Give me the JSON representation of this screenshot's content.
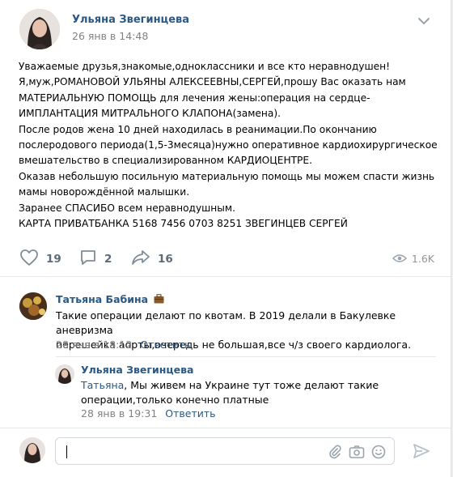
{
  "post": {
    "author": "Ульяна Звегинцева",
    "date": "26 янв в 14:48",
    "text": "Уважаемые друзья,знакомые,одноклассники и все кто неравнодушен!\nЯ,муж,РОМАНОВОЙ УЛЬЯНЫ АЛЕКСЕЕВНЫ,СЕРГЕЙ,прошу Вас оказать нам\nМАТЕРИАЛЬНУЮ ПОМОЩЬ для лечения жены:операция на сердце-\nИМПЛАНТАЦИЯ МИТРАЛЬНОГО КЛАПОНА(замена).\nПосле родов жена 10 дней находилась в реанимации.По окончанию\nпослеродового периода(1,5-3месяца)нужно оперативное кардиохирургическое\nвмешательство в специализированном КАРДИОЦЕНТРЕ.\nОказав небольшую посильную материальную помощь мы можем спасти жизнь\nмамы новорождённой малышки.\nЗаранее СПАСИБО всем неравнодушным.\nКАРТА ПРИВАТБАНКА 5168 7456 0703 8251 ЗВЕГИНЦЕВ СЕРГЕЙ"
  },
  "actions": {
    "likes": "19",
    "comments": "2",
    "shares": "16",
    "views": "1.6K"
  },
  "comments": [
    {
      "author": "Татьяна Бабина",
      "badge_icon": "briefcase-icon",
      "text": "Такие операции делают по квотам. В 2019 делали в Бакулевке аневризма\nперешейка аорты,очередь не большая,все ч/з своего кардиолога.",
      "date": "28 янв в 18:12",
      "reply_label": "Ответить"
    },
    {
      "author": "Ульяна Звегинцева",
      "reply_to": "Татьяна",
      "text": ", Мы живем на Украине тут тоже делают такие\nоперации,только конечно платные",
      "date": "28 янв в 19:31",
      "reply_label": "Ответить"
    }
  ],
  "colors": {
    "link": "#2a5885",
    "muted": "#828282",
    "icon": "#99a2ad",
    "border": "#dce1e6"
  }
}
